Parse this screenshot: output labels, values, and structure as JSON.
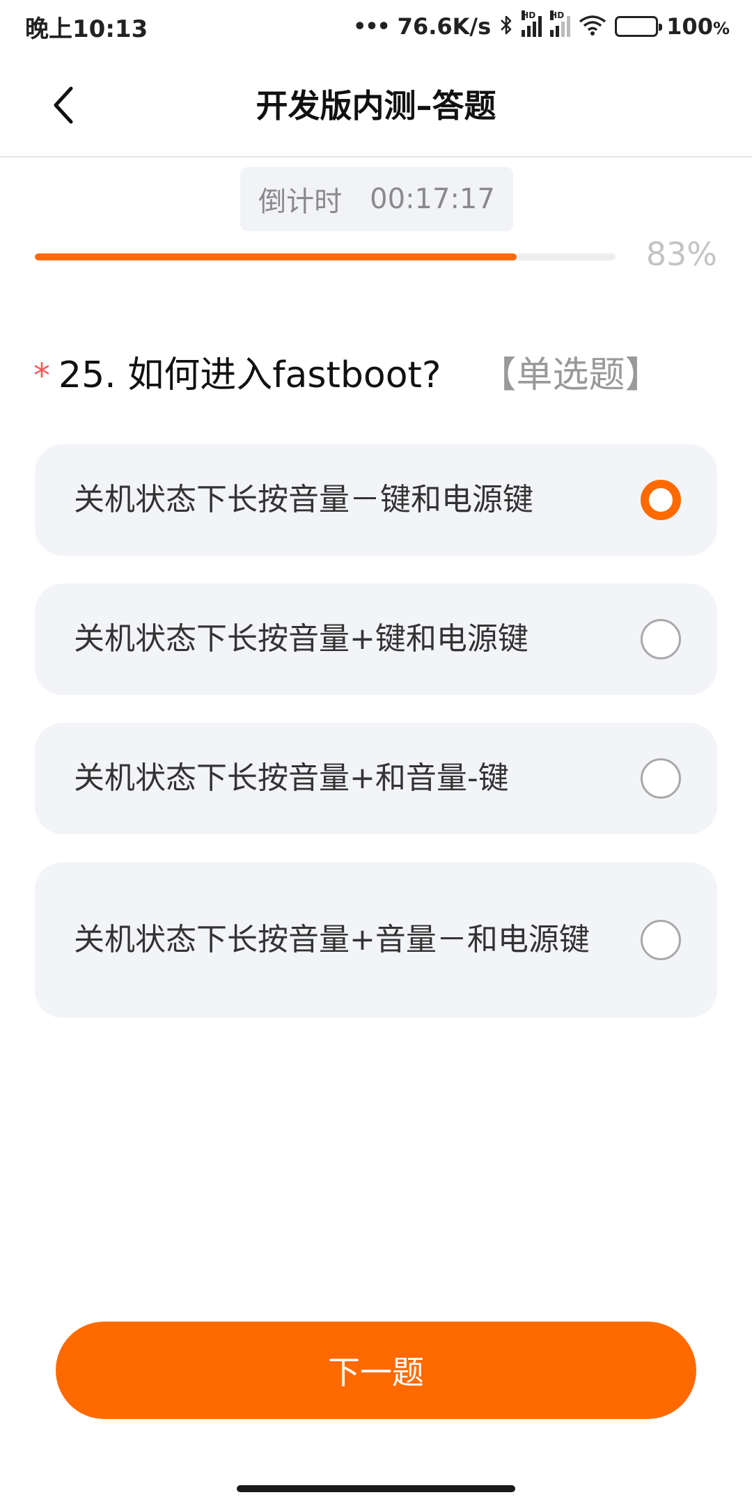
{
  "status_bar": {
    "time": "晚上10:13",
    "dots": "•••",
    "network_speed": "76.6K/s",
    "bluetooth_icon": "bluetooth-icon",
    "signal1_label": "HD",
    "signal2_label": "HD",
    "battery_percent": "100",
    "battery_unit": "%"
  },
  "header": {
    "title": "开发版内测–答题",
    "back_icon": "chevron-left-icon"
  },
  "countdown": {
    "label": "倒计时",
    "time": "00:17:17"
  },
  "progress": {
    "percent_value": 83,
    "percent_text": "83%",
    "color": "#ff6a00"
  },
  "question": {
    "required_mark": "*",
    "text": "25. 如何进入fastboot?",
    "type": "【单选题】"
  },
  "options": [
    {
      "label": "关机状态下长按音量－键和电源键",
      "selected": true
    },
    {
      "label": "关机状态下长按音量+键和电源键",
      "selected": false
    },
    {
      "label": "关机状态下长按音量+和音量-键",
      "selected": false
    },
    {
      "label": "关机状态下长按音量+音量－和电源键",
      "selected": false
    }
  ],
  "next_button": {
    "label": "下一题",
    "color": "#ff6a00"
  }
}
